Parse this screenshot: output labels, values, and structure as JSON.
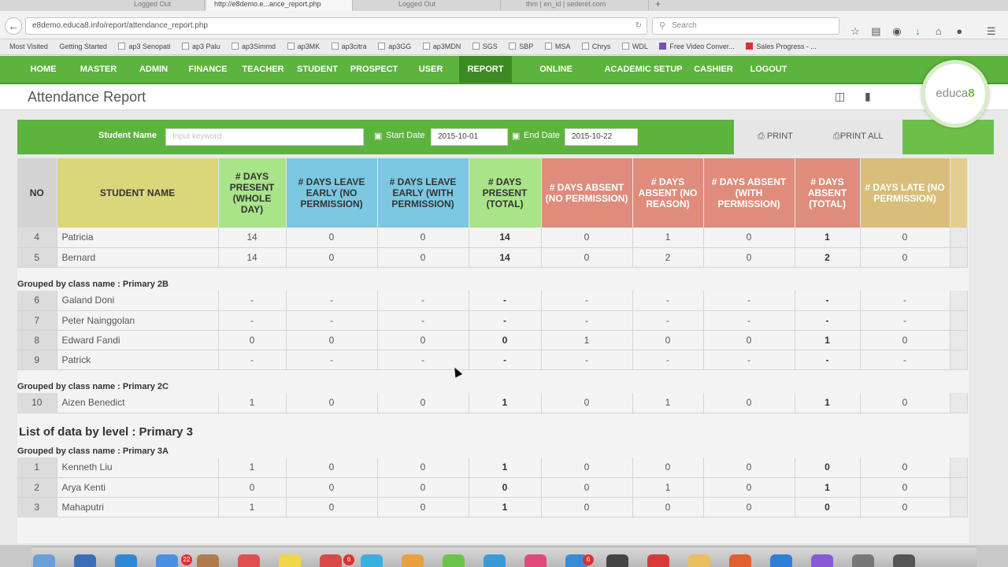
{
  "browser": {
    "tabs": [
      "Logged Out",
      "http://e8demo.e...ance_report.php",
      "Logged Out",
      "thm | en_id | sederet.com"
    ],
    "url": "e8demo.educa8.info/report/attendance_report.php",
    "search_placeholder": "Search",
    "bookmarks": [
      "Most Visited",
      "Getting Started",
      "ap3 Senopati",
      "ap3 Palu",
      "ap3Simmd",
      "ap3MK",
      "ap3citra",
      "ap3GG",
      "ap3MDN",
      "SGS",
      "SBP",
      "MSA",
      "Chrys",
      "WDL",
      "Free Video Conver...",
      "Sales Progress - ..."
    ]
  },
  "nav": {
    "items": [
      "HOME",
      "MASTER",
      "ADMIN",
      "FINANCE",
      "TEACHER",
      "STUDENT",
      "PROSPECT",
      "USER",
      "REPORT",
      "ONLINE LEARNING",
      "ACADEMIC SETUP",
      "CASHIER",
      "LOGOUT"
    ],
    "active": "REPORT"
  },
  "logo_text": {
    "prefix": "educa",
    "suffix": "8"
  },
  "page": {
    "title": "Attendance Report"
  },
  "filters": {
    "student_name_label": "Student Name",
    "student_name_placeholder": "Input keyword",
    "start_date_label": "Start Date",
    "start_date": "2015-10-01",
    "end_date_label": "End Date",
    "end_date": "2015-10-22",
    "print": "PRINT",
    "print_all": "PRINT ALL"
  },
  "table": {
    "columns": [
      {
        "label": "NO",
        "color": "#d3d3d3",
        "text": "#333333"
      },
      {
        "label": "STUDENT NAME",
        "color": "#d9d77a",
        "text": "#333333"
      },
      {
        "label": "# DAYS PRESENT (WHOLE DAY)",
        "color": "#a9e489",
        "text": "#333333"
      },
      {
        "label": "# DAYS LEAVE EARLY (NO PERMISSION)",
        "color": "#7cc8e2",
        "text": "#333333"
      },
      {
        "label": "# DAYS LEAVE EARLY (WITH PERMISSION)",
        "color": "#7cc8e2",
        "text": "#333333"
      },
      {
        "label": "# DAYS PRESENT (TOTAL)",
        "color": "#a9e489",
        "text": "#333333"
      },
      {
        "label": "# DAYS ABSENT (NO PERMISSION)",
        "color": "#df8c7c",
        "text": "#ffffff"
      },
      {
        "label": "# DAYS ABSENT (NO REASON)",
        "color": "#df8c7c",
        "text": "#ffffff"
      },
      {
        "label": "# DAYS ABSENT (WITH PERMISSION)",
        "color": "#df8c7c",
        "text": "#ffffff"
      },
      {
        "label": "# DAYS ABSENT (TOTAL)",
        "color": "#df8c7c",
        "text": "#ffffff"
      },
      {
        "label": "# DAYS LATE (NO PERMISSION)",
        "color": "#d8be78",
        "text": "#ffffff"
      }
    ],
    "rows": [
      {
        "type": "data",
        "cells": [
          "4",
          "Patricia",
          "14",
          "0",
          "0",
          "14",
          "0",
          "1",
          "0",
          "1",
          "0"
        ]
      },
      {
        "type": "data",
        "cells": [
          "5",
          "Bernard",
          "14",
          "0",
          "0",
          "14",
          "0",
          "2",
          "0",
          "2",
          "0"
        ]
      },
      {
        "type": "group",
        "label": "Grouped by class name : Primary 2B"
      },
      {
        "type": "data",
        "cells": [
          "6",
          "Galand Doni",
          "-",
          "-",
          "-",
          "-",
          "-",
          "-",
          "-",
          "-",
          "-"
        ]
      },
      {
        "type": "data",
        "cells": [
          "7",
          "Peter Nainggolan",
          "-",
          "-",
          "-",
          "-",
          "-",
          "-",
          "-",
          "-",
          "-"
        ]
      },
      {
        "type": "data",
        "cells": [
          "8",
          "Edward Fandi",
          "0",
          "0",
          "0",
          "0",
          "1",
          "0",
          "0",
          "1",
          "0"
        ]
      },
      {
        "type": "data",
        "cells": [
          "9",
          "Patrick",
          "-",
          "-",
          "-",
          "-",
          "-",
          "-",
          "-",
          "-",
          "-"
        ]
      },
      {
        "type": "group",
        "label": "Grouped by class name : Primary 2C"
      },
      {
        "type": "data",
        "cells": [
          "10",
          "Aizen Benedict",
          "1",
          "0",
          "0",
          "1",
          "0",
          "1",
          "0",
          "1",
          "0"
        ]
      },
      {
        "type": "level",
        "label": "List of data by level : Primary 3"
      },
      {
        "type": "group",
        "label": "Grouped by class name : Primary 3A"
      },
      {
        "type": "data",
        "cells": [
          "1",
          "Kenneth Liu",
          "1",
          "0",
          "0",
          "1",
          "0",
          "0",
          "0",
          "0",
          "0"
        ]
      },
      {
        "type": "data",
        "cells": [
          "2",
          "Arya Kenti",
          "0",
          "0",
          "0",
          "0",
          "0",
          "1",
          "0",
          "1",
          "0"
        ]
      },
      {
        "type": "data",
        "cells": [
          "3",
          "Mahaputri",
          "1",
          "0",
          "0",
          "1",
          "0",
          "0",
          "0",
          "0",
          "0"
        ]
      }
    ]
  },
  "dock": {
    "badges": [
      "22",
      "6",
      "6"
    ]
  }
}
